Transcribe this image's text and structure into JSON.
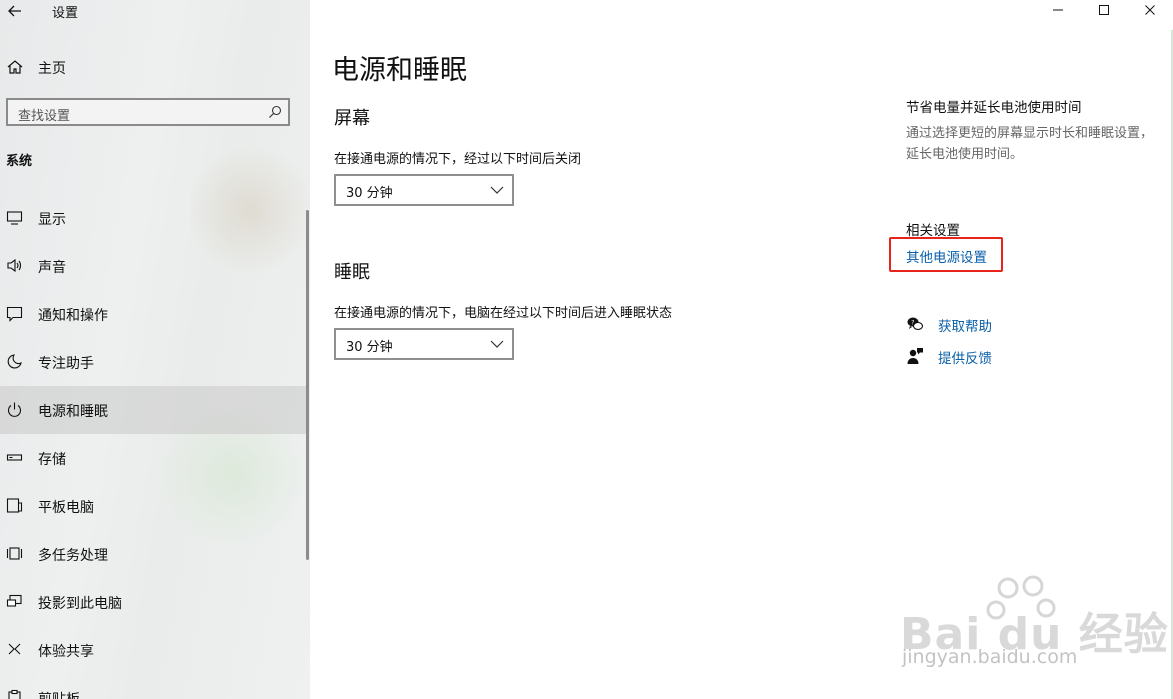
{
  "window": {
    "title": "设置",
    "minimize": "—",
    "maximize": "☐",
    "close": "✕"
  },
  "sidebar": {
    "home": "主页",
    "search_placeholder": "查找设置",
    "section": "系统",
    "items": [
      {
        "label": "显示",
        "icon": "monitor-icon"
      },
      {
        "label": "声音",
        "icon": "speaker-icon"
      },
      {
        "label": "通知和操作",
        "icon": "notification-icon"
      },
      {
        "label": "专注助手",
        "icon": "moon-icon"
      },
      {
        "label": "电源和睡眠",
        "icon": "power-icon",
        "selected": true
      },
      {
        "label": "存储",
        "icon": "storage-icon"
      },
      {
        "label": "平板电脑",
        "icon": "tablet-icon"
      },
      {
        "label": "多任务处理",
        "icon": "multitask-icon"
      },
      {
        "label": "投影到此电脑",
        "icon": "project-icon"
      },
      {
        "label": "体验共享",
        "icon": "share-icon"
      },
      {
        "label": "剪贴板",
        "icon": "clipboard-icon"
      }
    ]
  },
  "main": {
    "title": "电源和睡眠",
    "screen": {
      "heading": "屏幕",
      "desc": "在接通电源的情况下，经过以下时间后关闭",
      "value": "30 分钟"
    },
    "sleep": {
      "heading": "睡眠",
      "desc": "在接通电源的情况下，电脑在经过以下时间后进入睡眠状态",
      "value": "30 分钟"
    }
  },
  "side_panel": {
    "title": "节省电量并延长电池使用时间",
    "desc": "通过选择更短的屏幕显示时长和睡眠设置，延长电池使用时间。",
    "related": "相关设置",
    "link": "其他电源设置",
    "help": "获取帮助",
    "feedback": "提供反馈",
    "highlight_color": "#e8231b",
    "link_color": "#0a5fa8"
  },
  "watermark": {
    "brand": "Bai du 经验",
    "url": "jingyan.baidu.com"
  }
}
